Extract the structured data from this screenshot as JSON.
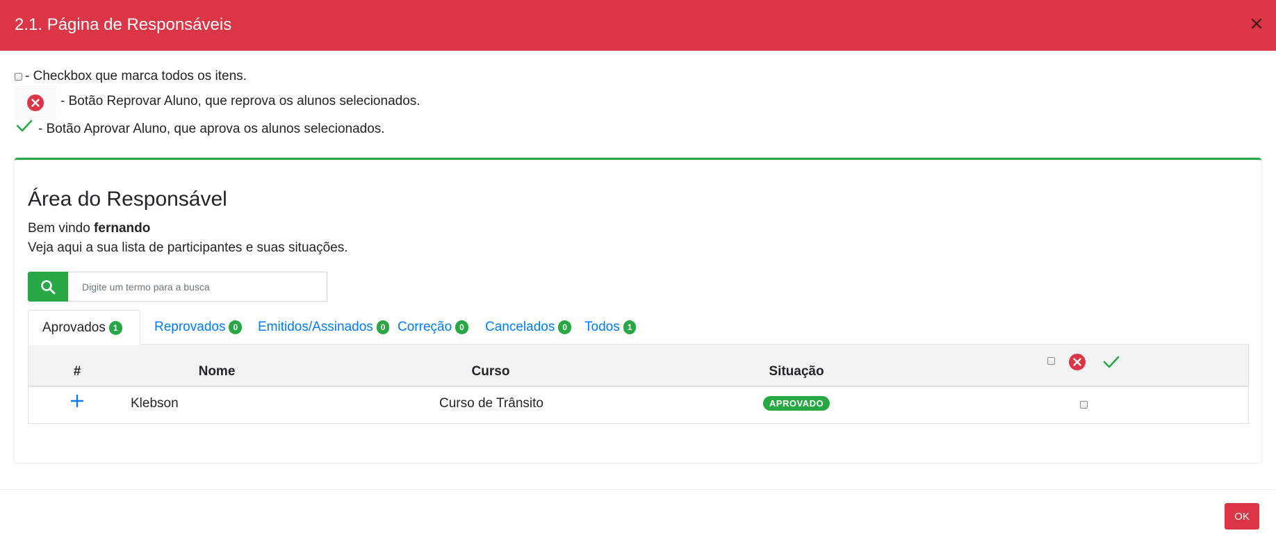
{
  "modal": {
    "title": "2.1. Página de Responsáveis",
    "ok_label": "OK"
  },
  "legend": {
    "checkbox_text": "- Checkbox que marca todos os itens.",
    "reject_text": "- Botão Reprovar Aluno, que reprova os alunos selecionados.",
    "approve_text": "- Botão Aprovar Aluno, que aprova os alunos selecionados."
  },
  "card": {
    "title": "Área do Responsável",
    "welcome_prefix": "Bem vindo ",
    "username": "fernando",
    "subtext": "Veja aqui a sua lista de participantes e suas situações."
  },
  "search": {
    "placeholder": "Digite um termo para a busca"
  },
  "tabs": [
    {
      "label": "Aprovados",
      "count": "1"
    },
    {
      "label": "Reprovados",
      "count": "0"
    },
    {
      "label": "Emitidos/Assinados",
      "count": "0"
    },
    {
      "label": "Correção",
      "count": "0"
    },
    {
      "label": "Cancelados",
      "count": "0"
    },
    {
      "label": "Todos",
      "count": "1"
    }
  ],
  "table": {
    "headers": [
      "#",
      "Nome",
      "Curso",
      "Situação"
    ],
    "rows": [
      {
        "name": "Klebson",
        "course": "Curso de Trânsito",
        "status": "APROVADO"
      }
    ]
  },
  "colors": {
    "header": "#dc3545",
    "success": "#28a745",
    "link": "#007bff",
    "danger": "#dc3545"
  },
  "icons": {
    "close": "close-icon",
    "reject": "x-circle-icon",
    "approve": "check-icon",
    "search": "search-icon",
    "expand": "plus-icon"
  }
}
